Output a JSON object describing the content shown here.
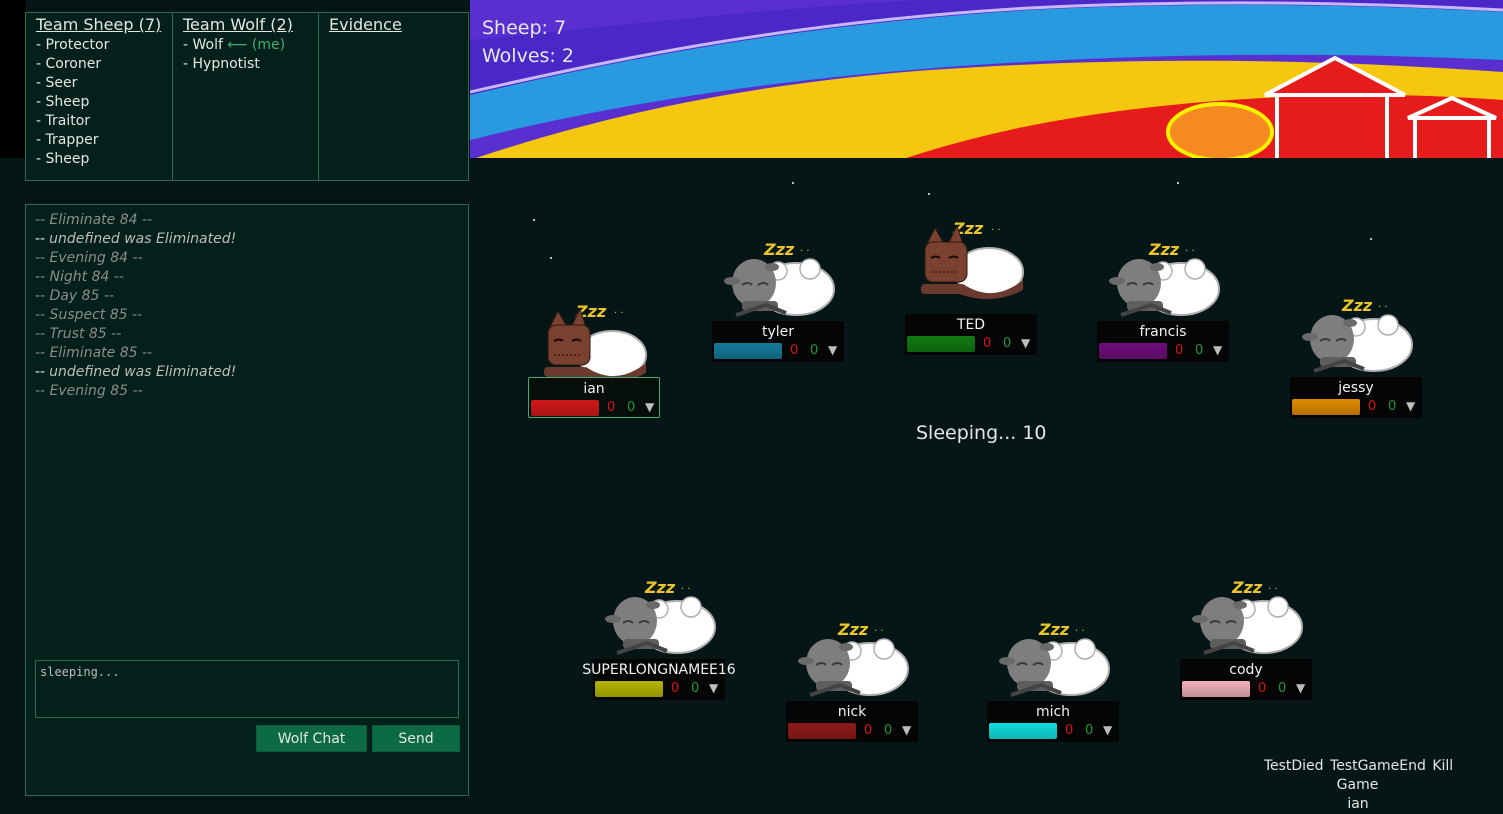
{
  "teams": {
    "sheep_header": "Team Sheep (7)",
    "sheep_roles": [
      "- Protector",
      "- Coroner",
      "- Seer",
      "- Sheep",
      "- Traitor",
      "- Trapper",
      "- Sheep"
    ],
    "wolf_header": "Team Wolf (2)",
    "wolf_roles": [
      "- Wolf",
      "- Hypnotist"
    ],
    "wolf_me_tag": "⟵ (me)",
    "evidence_header": "Evidence"
  },
  "counts": {
    "sheep": "Sheep: 7",
    "wolves": "Wolves: 2"
  },
  "chat": {
    "log": [
      {
        "text": "-- Eliminate 84 --",
        "kind": "phase"
      },
      {
        "text": "undefined was Eliminated!",
        "kind": "elim"
      },
      {
        "text": "-- Evening 84 --",
        "kind": "phase"
      },
      {
        "text": "-- Night 84 --",
        "kind": "phase"
      },
      {
        "text": "-- Day 85 --",
        "kind": "phase"
      },
      {
        "text": "-- Suspect 85 --",
        "kind": "phase"
      },
      {
        "text": "-- Trust 85 --",
        "kind": "phase"
      },
      {
        "text": "-- Eliminate 85 --",
        "kind": "phase"
      },
      {
        "text": "undefined was Eliminated!",
        "kind": "elim"
      },
      {
        "text": "-- Evening 85 --",
        "kind": "phase"
      }
    ],
    "input_placeholder": "sleeping...",
    "wolf_chat_label": "Wolf Chat",
    "send_label": "Send"
  },
  "timer": "Sleeping... 10",
  "players": [
    {
      "name": "ian",
      "color": "#d11818",
      "suspect": "0",
      "trust": "0",
      "avatar": "wolf",
      "selected": true
    },
    {
      "name": "tyler",
      "color": "#157a9a",
      "suspect": "0",
      "trust": "0",
      "avatar": "sheep",
      "selected": false
    },
    {
      "name": "TED",
      "color": "#117a11",
      "suspect": "0",
      "trust": "0",
      "avatar": "wolf",
      "selected": false
    },
    {
      "name": "francis",
      "color": "#6e0d7a",
      "suspect": "0",
      "trust": "0",
      "avatar": "sheep",
      "selected": false
    },
    {
      "name": "jessy",
      "color": "#e08a00",
      "suspect": "0",
      "trust": "0",
      "avatar": "sheep",
      "selected": false
    },
    {
      "name": "SUPERLONGNAMEE16",
      "color": "#b5b500",
      "suspect": "0",
      "trust": "0",
      "avatar": "sheep",
      "selected": false
    },
    {
      "name": "nick",
      "color": "#8f1a1a",
      "suspect": "0",
      "trust": "0",
      "avatar": "sheep",
      "selected": false
    },
    {
      "name": "mich",
      "color": "#11dede",
      "suspect": "0",
      "trust": "0",
      "avatar": "sheep",
      "selected": false
    },
    {
      "name": "cody",
      "color": "#f0b0ba",
      "suspect": "0",
      "trust": "0",
      "avatar": "sheep",
      "selected": false
    }
  ],
  "debug_buttons": [
    "TestDied",
    "TestGameEnd",
    "Kill Game"
  ],
  "debug_user": "ian"
}
